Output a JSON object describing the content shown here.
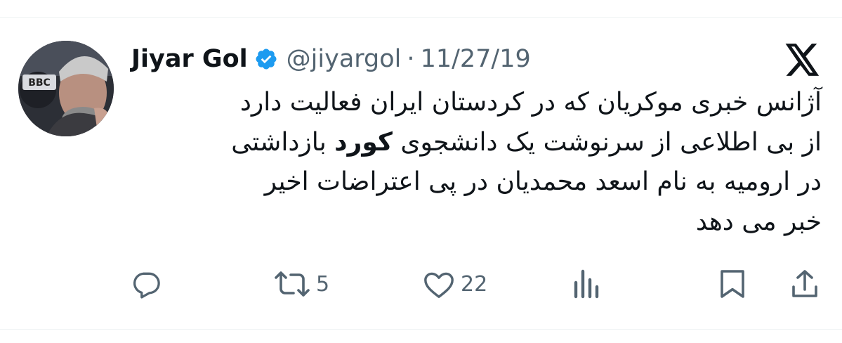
{
  "author": {
    "display_name": "Jiyar Gol",
    "handle": "@jiyargol",
    "separator": "·",
    "date": "11/27/19",
    "verified": true,
    "avatar_icon": "profile-photo",
    "avatar_badge_text": "BBC"
  },
  "tweet": {
    "lines": [
      "آژانس خبری موکریان که در کردستان ایران فعالیت دارد",
      "از بی اطلاعی از سرنوشت  یک دانشجوی ",
      "کورد",
      " بازداشتی",
      "در ارومیه به نام اسعد محمدیان  در پی اعتراضات اخیر",
      "خبر می دهد"
    ]
  },
  "actions": {
    "reply": {
      "icon": "reply-icon",
      "count": ""
    },
    "repost": {
      "icon": "repost-icon",
      "count": "5"
    },
    "like": {
      "icon": "heart-icon",
      "count": "22"
    },
    "views": {
      "icon": "views-icon",
      "count": ""
    },
    "bookmark": {
      "icon": "bookmark-icon"
    },
    "share": {
      "icon": "share-icon"
    }
  },
  "colors": {
    "text": "#0f1419",
    "secondary": "#536471",
    "verified": "#1d9bf0",
    "rule": "#eff3f4"
  }
}
